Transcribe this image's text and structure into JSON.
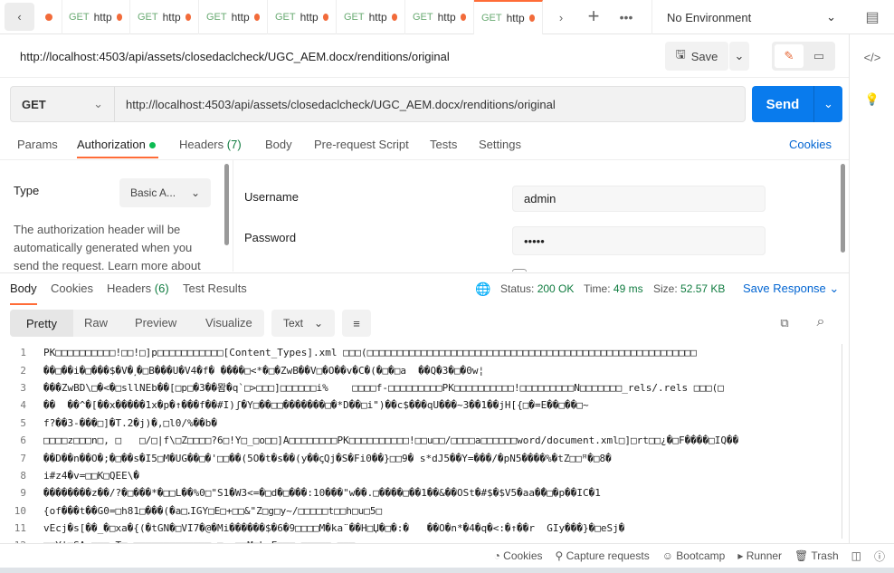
{
  "tabs": [
    {
      "method": "GET",
      "label": "http"
    },
    {
      "method": "GET",
      "label": "http"
    },
    {
      "method": "GET",
      "label": "http"
    },
    {
      "method": "GET",
      "label": "http"
    },
    {
      "method": "GET",
      "label": "http"
    },
    {
      "method": "GET",
      "label": "http"
    },
    {
      "method": "GET",
      "label": "http",
      "active": true
    }
  ],
  "environment": "No Environment",
  "request": {
    "title": "http://localhost:4503/api/assets/closedaclcheck/UGC_AEM.docx/renditions/original",
    "method": "GET",
    "url": "http://localhost:4503/api/assets/closedaclcheck/UGC_AEM.docx/renditions/original",
    "save_label": "Save",
    "send_label": "Send"
  },
  "request_tabs": {
    "params": "Params",
    "authorization": "Authorization",
    "headers": "Headers",
    "headers_count": "(7)",
    "body": "Body",
    "pre_request": "Pre-request Script",
    "tests": "Tests",
    "settings": "Settings",
    "cookies": "Cookies"
  },
  "auth": {
    "type_label": "Type",
    "type_value": "Basic A...",
    "description": "The authorization header will be automatically generated when you send the request. Learn more about",
    "username_label": "Username",
    "username_value": "admin",
    "password_label": "Password",
    "password_value": "•••••"
  },
  "response_tabs": {
    "body": "Body",
    "cookies": "Cookies",
    "headers": "Headers",
    "headers_count": "(6)",
    "test_results": "Test Results"
  },
  "response_meta": {
    "status_label": "Status:",
    "status": "200 OK",
    "time_label": "Time:",
    "time": "49 ms",
    "size_label": "Size:",
    "size": "52.57 KB",
    "save_response": "Save Response"
  },
  "view_modes": [
    "Pretty",
    "Raw",
    "Preview",
    "Visualize"
  ],
  "format": "Text",
  "body_lines": [
    "PK□□□□□□□□□□!□□!□]p□□□□□□□□□□□[Content_Types].xml □□□(□□□□□□□□□□□□□□□□□□□□□□□□□□□□□□□□□□□□□□□□□□□□□□□□□□□□□□□",
    "��□��i�□���$�V�˼�□B���U�V4�f� ����□<*�□�ZwB��V□�O��v�C�(�□�□a  ��Q�3�□�0w¦",
    "���ZwBD\\□�<�□sllNEb��[□p□�3��뫔�q`□>□□□]□□□□□□i%    □□□□f-□□□□□□□□□PK□□□□□□□□□□!□□□□□□□□□N□□□□□□□_rels/.rels □□□(□",
    "��  ��^�[��x�����1x�p�↑���f��#I)ʃ�Y□��□□�������□�*D��□i\")��c$���qU���~3��1��jH[{□�=E��□��□~",
    "f?��3-���□]�T.2�j)�,□l0/%��b�",
    "□□□□z□□□n□, □   □/□|f\\□Z□□□□?6□!Y□_□o□□]A□□□□□□□□PK□□□□□□□□□□!□□u□□/□□□□a□□□□□□word/document.xml□]□rt□□¿�□F����□IQ��",
    "��D��n��O�;�□��s�I5□M�UG��□�'□□��(5O�t�s��(y��ꞔQj�S�Fi0��}□□9� s*dJ5��Y=���/�pN5����%�tZ□□ꟸ�□8�",
    "i#z4�v=□□K□QEE\\�",
    "��������z��/?�□���*�□□L��%0□\"S1�W3<=�□d�□���:10���\"w��.□����□��1��&��OSt�#$�$V5�aa�̆�□�p��IC�1",
    "{of���t��G0=□h81□���(�a□ꓸIGY□E□+□□&\"Z□g□y~/□□□□□t□□h□u□5□",
    "vEcj�s[��_�□xa�{(�tGN�□VI7�@�Mi������$�6�9□□□□M�ka¨��H□Џ�□�:�   ��O�n*�4�q�<:�↑��r  GIy���}�□eSj�",
    "□□Y|□SAo□□□eT□ □□□□□□□□□□□□□:□ox□□M□kvF□□□.□□□□□c□□□"
  ],
  "statusbar": {
    "cookies": "Cookies",
    "capture": "Capture requests",
    "bootcamp": "Bootcamp",
    "runner": "Runner",
    "trash": "Trash"
  },
  "colors": {
    "accent": "#ff6c37",
    "send": "#097bed",
    "link": "#0265d2",
    "status_ok": "#0f7b3f",
    "method_get": "#6aab73"
  }
}
